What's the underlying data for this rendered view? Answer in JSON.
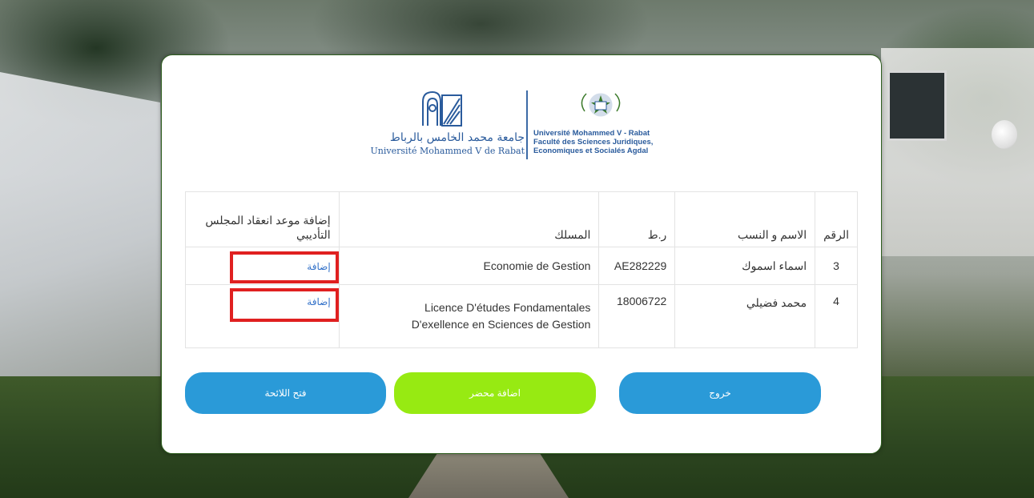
{
  "university": {
    "name_ar": "جامعة محمد الخامس بالرباط",
    "name_fr": "Université Mohammed V de Rabat",
    "faculty_lines": [
      "Université Mohammed V - Rabat",
      "Faculté des Sciences Juridiques,",
      "Economiques et Socialés  Agdal"
    ]
  },
  "table": {
    "headers": {
      "num": "الرقم",
      "name": "الاسم و النسب",
      "cne": "ر.ط",
      "field": "المسلك",
      "action": "إضافة موعد انعقاد المجلس التأديبي"
    },
    "rows": [
      {
        "num": "3",
        "name": "اسماء اسموك",
        "cne": "AE282229",
        "field_line1": "Economie de Gestion",
        "field_line2": "",
        "action": "إضافة"
      },
      {
        "num": "4",
        "name": "محمد فضيلي",
        "cne": "18006722",
        "field_line1": "Licence D'études Fondamentales",
        "field_line2": "D'exellence en Sciences de Gestion",
        "action": "إضافة"
      }
    ]
  },
  "buttons": {
    "open_list": "فتح اللائحة",
    "add_report": "اضافة محضر",
    "exit": "خروج"
  },
  "colors": {
    "primary_button": "#2a9ad8",
    "add_button": "#97ea12",
    "highlight": "#e02020",
    "link": "#3573c9"
  }
}
